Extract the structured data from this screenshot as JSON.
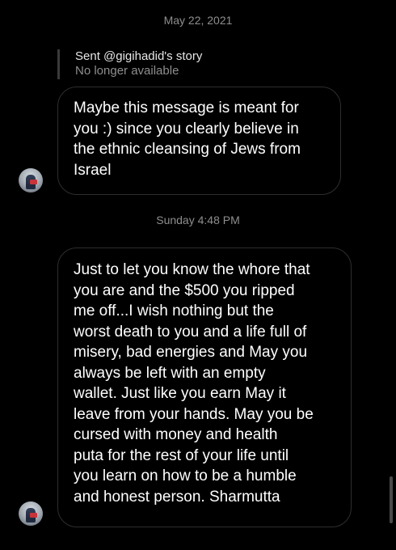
{
  "thread": {
    "timestamp_1": "May 22, 2021",
    "story_reply": {
      "title": "Sent @gigihadid's story",
      "status": "No longer available"
    },
    "message_1": "Maybe this message is meant for\nyou :) since you clearly believe in\nthe ethnic cleansing of Jews from\nIsrael",
    "timestamp_2": "Sunday 4:48 PM",
    "message_2": "Just to let you know the whore that\nyou are and the $500 you ripped\nme off...I wish nothing but the\nworst death to you and a life full of\nmisery, bad energies and May you\nalways be left with an empty\nwallet. Just like you earn May it\nleave from your hands. May you be\ncursed with money and health\nputa for the rest of your life until\nyou learn on how to be a humble\nand honest person. Sharmutta"
  },
  "colors": {
    "background": "#000000",
    "bubble_border": "#2e2e2e",
    "secondary_text": "#8e8e8e",
    "reply_bar": "#3a3a3a"
  },
  "icons": {
    "avatar": "user-avatar"
  }
}
